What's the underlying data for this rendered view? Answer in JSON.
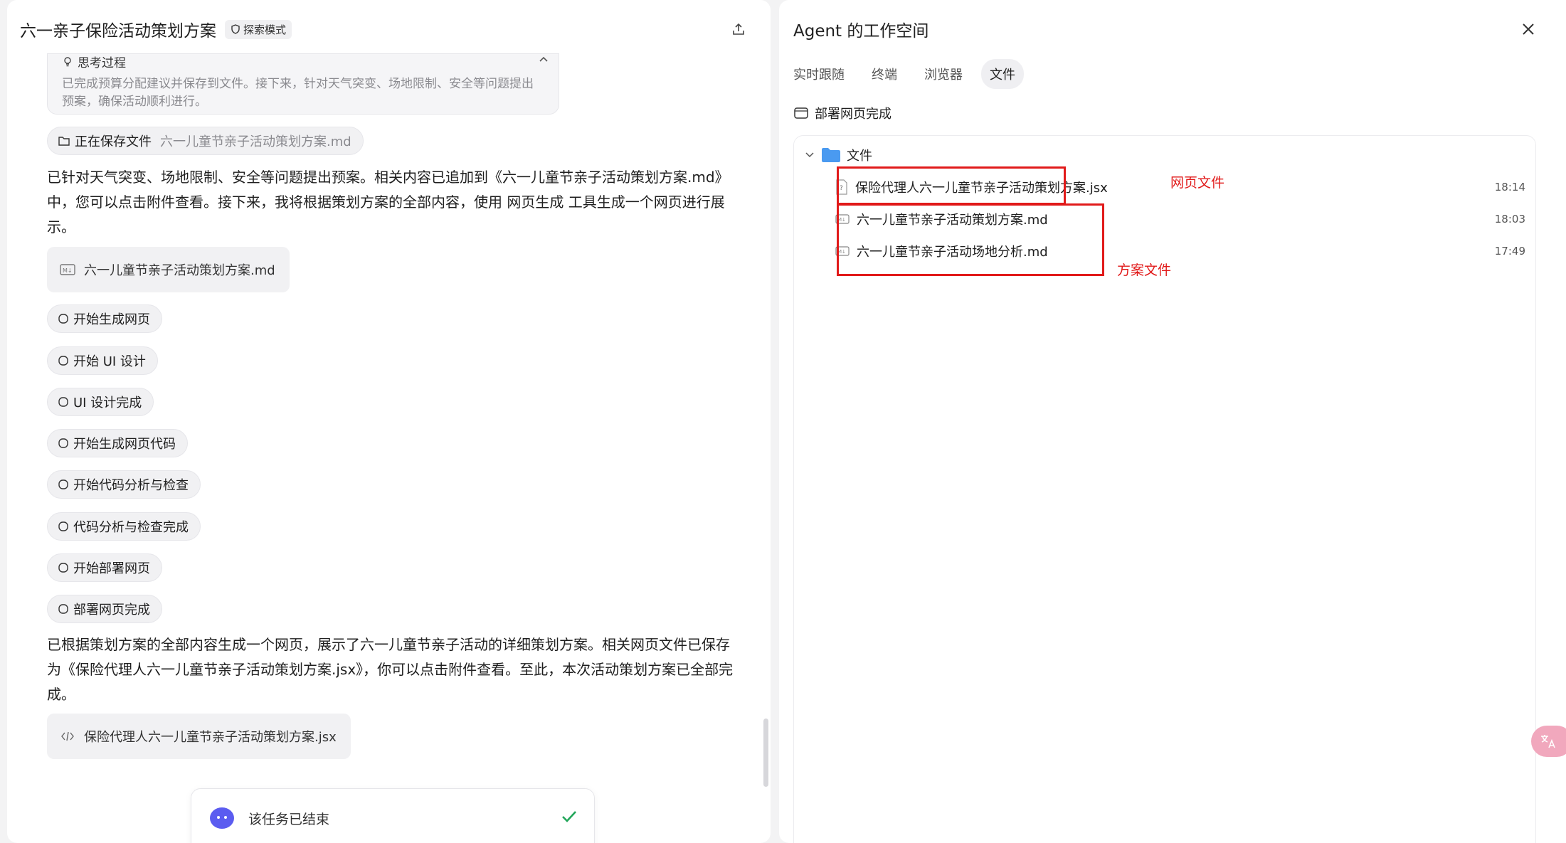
{
  "left": {
    "title": "六一亲子保险活动策划方案",
    "mode_badge": "探索模式",
    "thinking": {
      "label": "思考过程",
      "text": "已完成预算分配建议并保存到文件。接下来，针对天气突变、场地限制、安全等问题提出预案，确保活动顺利进行。"
    },
    "saving_chip": {
      "label": "正在保存文件",
      "file": "六一儿童节亲子活动策划方案.md"
    },
    "para1": "已针对天气突变、场地限制、安全等问题提出预案。相关内容已追加到《六一儿童节亲子活动策划方案.md》中，您可以点击附件查看。接下来，我将根据策划方案的全部内容，使用 网页生成 工具生成一个网页进行展示。",
    "attachment1": "六一儿童节亲子活动策划方案.md",
    "steps": [
      "开始生成网页",
      "开始 UI 设计",
      "UI 设计完成",
      "开始生成网页代码",
      "开始代码分析与检查",
      "代码分析与检查完成",
      "开始部署网页",
      "部署网页完成"
    ],
    "para2": "已根据策划方案的全部内容生成一个网页，展示了六一儿童节亲子活动的详细策划方案。相关网页文件已保存为《保险代理人六一儿童节亲子活动策划方案.jsx》，你可以点击附件查看。至此，本次活动策划方案已全部完成。",
    "attachment2": "保险代理人六一儿童节亲子活动策划方案.jsx",
    "end_text": "该任务已结束"
  },
  "right": {
    "title": "Agent 的工作空间",
    "tabs": [
      "实时跟随",
      "终端",
      "浏览器",
      "文件"
    ],
    "active_tab": 3,
    "status": "部署网页完成",
    "folder": "文件",
    "files": [
      {
        "name": "保险代理人六一儿童节亲子活动策划方案.jsx",
        "time": "18:14"
      },
      {
        "name": "六一儿童节亲子活动策划方案.md",
        "time": "18:03"
      },
      {
        "name": "六一儿童节亲子活动场地分析.md",
        "time": "17:49"
      }
    ],
    "annotations": {
      "web_file": "网页文件",
      "plan_file": "方案文件"
    }
  },
  "colors": {
    "annotation": "#e11a1a",
    "accent": "#5b5cf0",
    "folder": "#4a9af0",
    "check": "#22a65a"
  }
}
